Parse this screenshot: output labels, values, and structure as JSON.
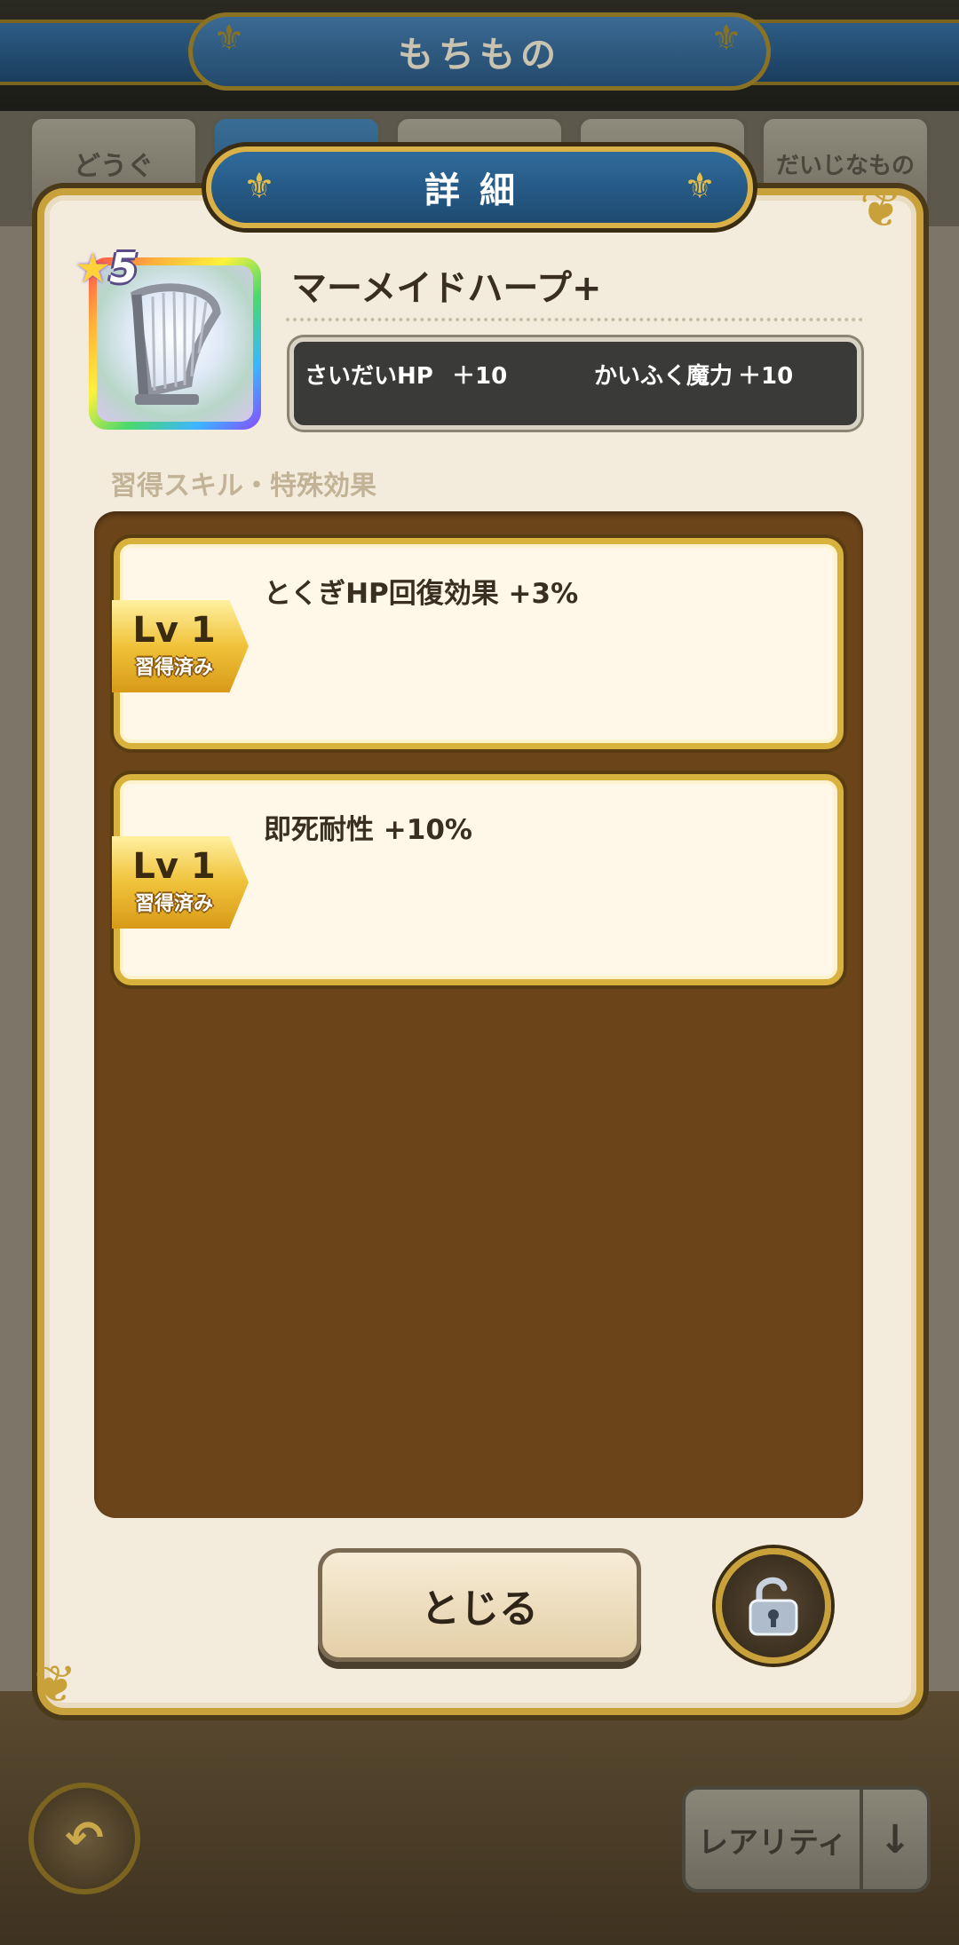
{
  "background": {
    "screen_title": "もちもの",
    "tabs": [
      "どうぐ",
      "",
      "",
      "",
      "だいじなもの"
    ],
    "sort_label": "レアリティ",
    "sort_arrow": "↓"
  },
  "dialog": {
    "title": "詳細",
    "item": {
      "rarity_stars": "5",
      "name": "マーメイドハープ+",
      "icon": "harp-icon",
      "stats": [
        {
          "label": "さいだいHP",
          "value": "＋10"
        },
        {
          "label": "かいふく魔力",
          "value": "＋10"
        }
      ]
    },
    "section_label": "習得スキル・特殊効果",
    "skills": [
      {
        "lv": "Lv 1",
        "state": "習得済み",
        "text": "とくぎHP回復効果 +3%"
      },
      {
        "lv": "Lv 1",
        "state": "習得済み",
        "text": "即死耐性 +10%"
      }
    ],
    "close_label": "とじる",
    "lock_icon": "unlock-icon"
  },
  "colors": {
    "gold": "#c9a13a",
    "header_blue": "#1e4a70",
    "panel_brown": "#6b441a",
    "card_cream": "#fff8e8"
  }
}
